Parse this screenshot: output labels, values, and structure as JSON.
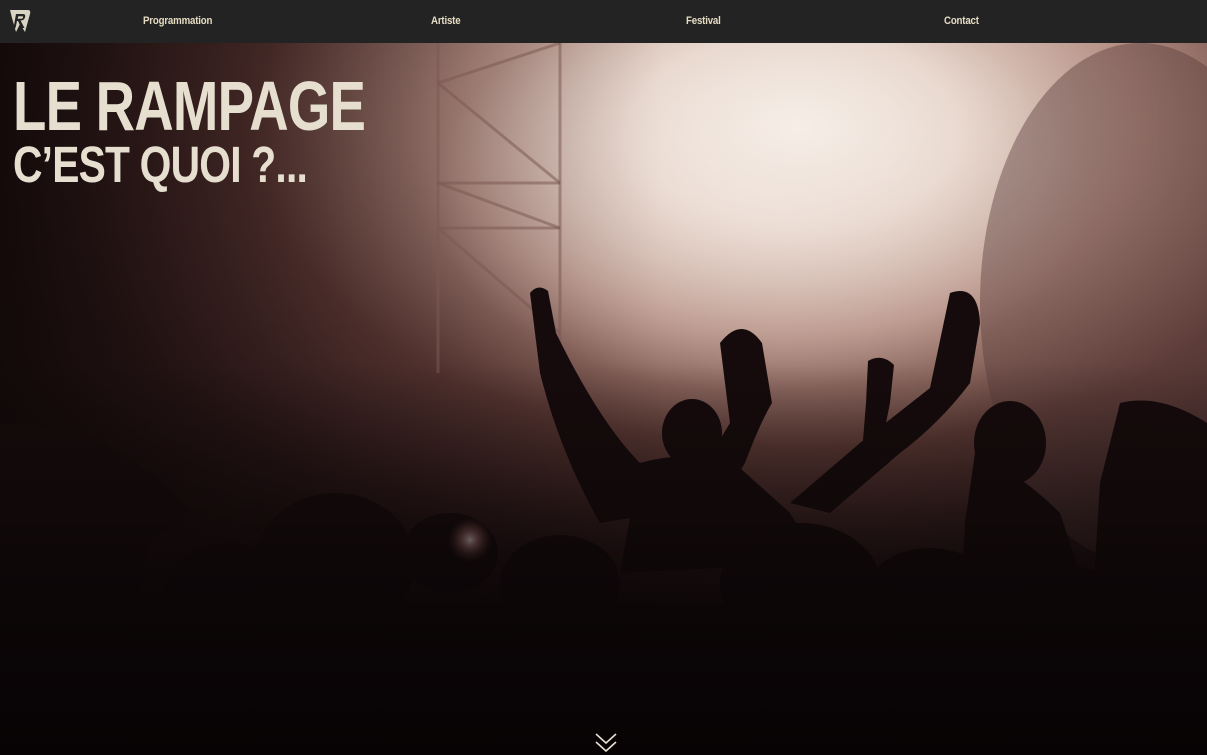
{
  "nav": {
    "logo_icon": "rampage-logo-icon",
    "items": [
      {
        "label": "Programmation"
      },
      {
        "label": "Artiste"
      },
      {
        "label": "Festival"
      },
      {
        "label": "Contact"
      }
    ],
    "text_color": "#e6dcc3",
    "background": "#232323"
  },
  "hero": {
    "title": "LE RAMPAGE",
    "subtitle": "C’EST QUOI ?...",
    "scroll_icon": "double-chevron-down-icon",
    "text_color": "#e6dfd0"
  }
}
